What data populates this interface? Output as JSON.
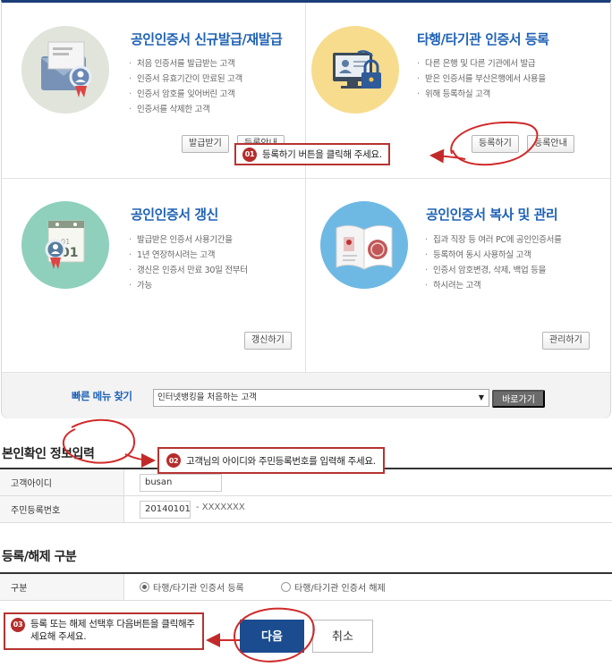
{
  "cards": [
    {
      "title": "공인인증서 신규발급/재발급",
      "items": [
        "처음 인증서를 발급받는 고객",
        "인증서 유효기간이 만료된 고객",
        "인증서 암호를 잊어버린 고객",
        "인증서를 삭제한 고객"
      ],
      "buttons": [
        "발급받기",
        "등록안내"
      ]
    },
    {
      "title": "타행/타기관 인증서 등록",
      "items": [
        "다른 은행 및 다른 기관에서 발급",
        "받은 인증서를 부산은행에서 사용을",
        "위해 등록하실 고객"
      ],
      "buttons": [
        "등록하기",
        "등록안내"
      ]
    },
    {
      "title": "공인인증서 갱신",
      "items": [
        "발급받은 인증서 사용기간을",
        "1년 연장하시려는 고객",
        "갱신은 인증서 만료 30일 전부터",
        "가능"
      ],
      "buttons": [
        "갱신하기"
      ]
    },
    {
      "title": "공인인증서 복사 및 관리",
      "items": [
        "집과 직장 등 여러 PC에 공인인증서를",
        "등록하여 동시 사용하실 고객",
        "인증서 암호변경, 삭제, 백업 등을",
        "하시려는 고객"
      ],
      "buttons": [
        "관리하기"
      ]
    }
  ],
  "quick_menu": {
    "label": "빠른 메뉴 찾기",
    "selected": "인터넷뱅킹을 처음하는 고객",
    "go_label": "바로가기"
  },
  "identity": {
    "title": "본인확인 정보입력",
    "id_label": "고객아이디",
    "id_value": "busan",
    "rrn_label": "주민등록번호",
    "rrn_front": "20140101",
    "rrn_back": "- XXXXXXX"
  },
  "reg": {
    "title": "등록/해제 구분",
    "label": "구분",
    "options": [
      "타행/타기관 인증서 등록",
      "타행/타기관 인증서 해제"
    ],
    "selected_index": 0
  },
  "actions": {
    "next": "다음",
    "cancel": "취소"
  },
  "callouts": [
    {
      "num": "01",
      "text": "등록하기 버튼을 클릭해 주세요."
    },
    {
      "num": "02",
      "text": "고객님의 아이디와 주민등록번호를 입력해 주세요."
    },
    {
      "num": "03",
      "text": "등록 또는 해제 선택후 다음버튼을 클릭해주세요해 주세요."
    }
  ],
  "colors": {
    "accent_blue": "#1f62b6",
    "navy": "#1a4c8f",
    "callout_red": "#b63330"
  }
}
